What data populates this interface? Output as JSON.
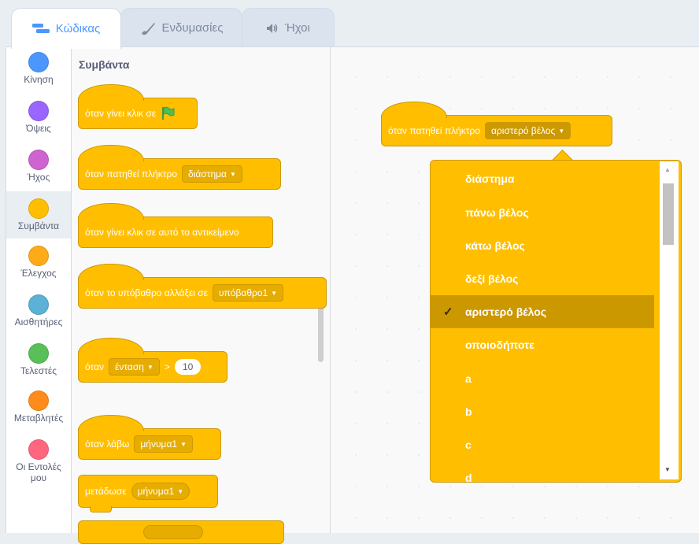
{
  "tabs": [
    {
      "label": "Κώδικας",
      "icon": "code-icon",
      "active": true
    },
    {
      "label": "Ενδυμασίες",
      "icon": "brush-icon",
      "active": false
    },
    {
      "label": "Ήχοι",
      "icon": "speaker-icon",
      "active": false
    }
  ],
  "categories": [
    {
      "label": "Κίνηση",
      "color": "#4c97ff"
    },
    {
      "label": "Όψεις",
      "color": "#9966ff"
    },
    {
      "label": "Ήχος",
      "color": "#cf63cf"
    },
    {
      "label": "Συμβάντα",
      "color": "#ffbf00",
      "selected": true
    },
    {
      "label": "Έλεγχος",
      "color": "#ffab19"
    },
    {
      "label": "Αισθητήρες",
      "color": "#5cb1d6"
    },
    {
      "label": "Τελεστές",
      "color": "#59c059"
    },
    {
      "label": "Μεταβλητές",
      "color": "#ff8c1a"
    },
    {
      "label": "Οι Εντολές μου",
      "color": "#ff6680"
    }
  ],
  "palette": {
    "title": "Συμβάντα",
    "blocks": {
      "flag": "όταν γίνει κλικ σε",
      "key": "όταν πατηθεί πλήκτρο",
      "key_value": "διάστημα",
      "sprite": "όταν γίνει κλικ σε αυτό το αντικείμενο",
      "backdrop": "όταν το υπόβαθρο αλλάξει σε",
      "backdrop_value": "υπόβαθρο1",
      "when": "όταν",
      "sensor_value": "ένταση",
      "op": ">",
      "number": "10",
      "receive": "όταν λάβω",
      "message_value": "μήνυμα1",
      "broadcast": "μετάδωσε",
      "broadcast_value": "μήνυμα1"
    }
  },
  "workspace": {
    "block_label": "όταν πατηθεί πλήκτρο",
    "block_value": "αριστερό βέλος"
  },
  "dropdown": {
    "options": [
      "διάστημα",
      "πάνω βέλος",
      "κάτω βέλος",
      "δεξί βέλος",
      "αριστερό βέλος",
      "οποιοδήποτε",
      "a",
      "b",
      "c",
      "d"
    ],
    "selected": "αριστερό βέλος",
    "check": "✓"
  }
}
